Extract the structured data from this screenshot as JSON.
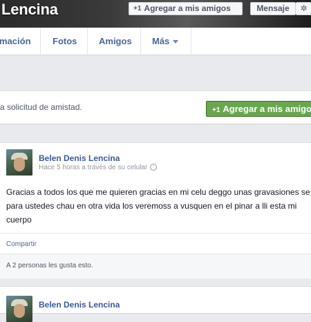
{
  "header": {
    "profile_name": "Lencina",
    "add_friend_label": "Agregar a mis amigos",
    "message_label": "Mensaje",
    "add_glyph": "+1",
    "gear_glyph": "✲"
  },
  "tabs": [
    {
      "label": "mación"
    },
    {
      "label": "Fotos"
    },
    {
      "label": "Amigos"
    },
    {
      "label": "Más"
    }
  ],
  "friend_request": {
    "text": "a solicitud de amistad.",
    "button_label": "Agregar a mis amigos",
    "button_color": "#69a74e"
  },
  "posts": [
    {
      "author": "Belen Denis Lencina",
      "meta": "Hace 5 horas a través de su celular",
      "body": "Gracias a todos los que me quieren gracias en mi celu deggo unas gravasiones se para ustedes chau en otra vida los veremoss a vusquen en el pinar a lli esta mi cuerpo",
      "share_label": "Compartir",
      "likes": "A 2 personas les gusta esto."
    },
    {
      "author": "Belen Denis Lencina"
    }
  ],
  "colors": {
    "link": "#3b5998",
    "page_bg": "#e9eaed"
  }
}
